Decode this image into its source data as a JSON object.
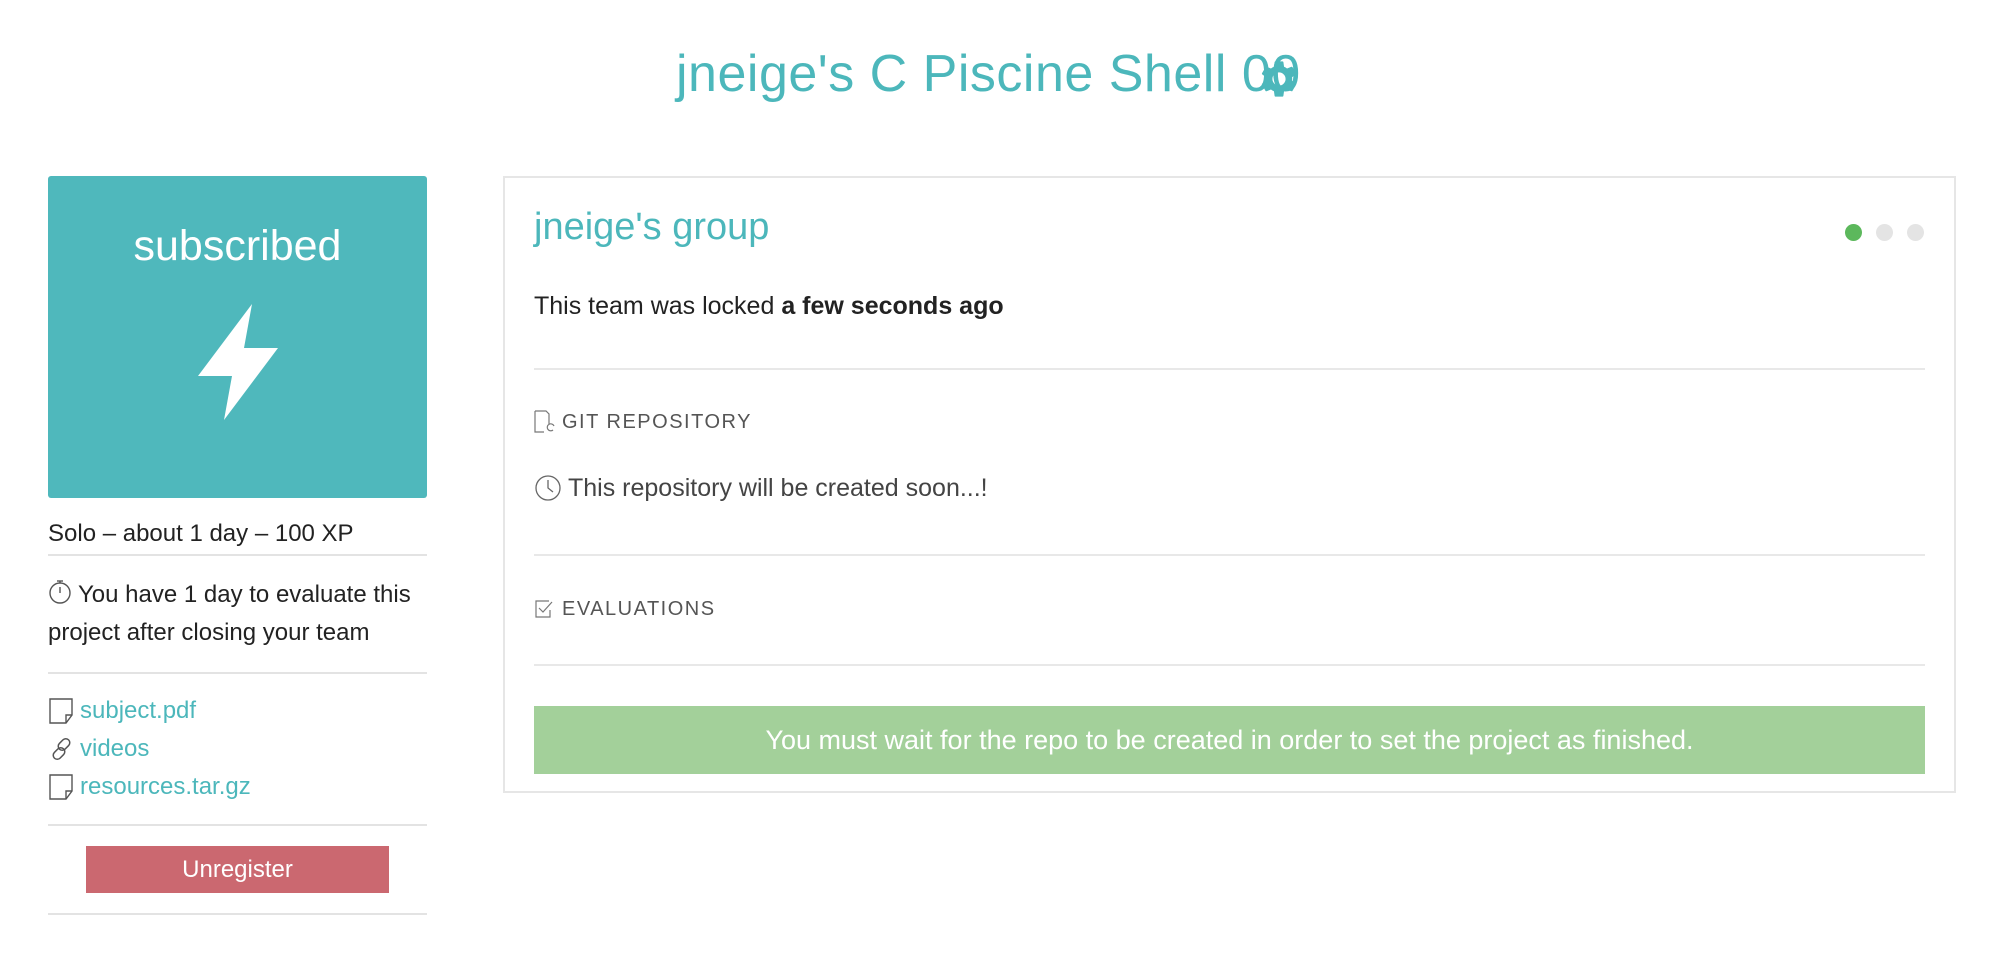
{
  "header": {
    "title": "jneige's C Piscine Shell 00",
    "settings_icon": "gear-icon",
    "accent_color": "#4cb7bb"
  },
  "sidebar": {
    "status": "subscribed",
    "status_icon": "lightning-bolt-icon",
    "status_color": "#4fb8bc",
    "meta": "Solo – about 1 day – 100 XP",
    "evaluation_note": "You have 1 day to evaluate this project after closing your team",
    "links": [
      {
        "label": "subject.pdf",
        "icon": "document-icon"
      },
      {
        "label": "videos",
        "icon": "link-icon"
      },
      {
        "label": "resources.tar.gz",
        "icon": "document-icon"
      }
    ],
    "unregister_label": "Unregister",
    "unregister_color": "#cb6870"
  },
  "team": {
    "name": "jneige's group",
    "lock_prefix": "This team was locked ",
    "lock_time": "a few seconds ago",
    "steps_total": 3,
    "steps_active": 1,
    "git_section_title": "GIT REPOSITORY",
    "repo_note": "This repository will be created soon...!",
    "evaluations_section_title": "EVALUATIONS",
    "finish_message": "You must wait for the repo to be created in order to set the project as finished.",
    "finish_color": "#a3d09a"
  }
}
